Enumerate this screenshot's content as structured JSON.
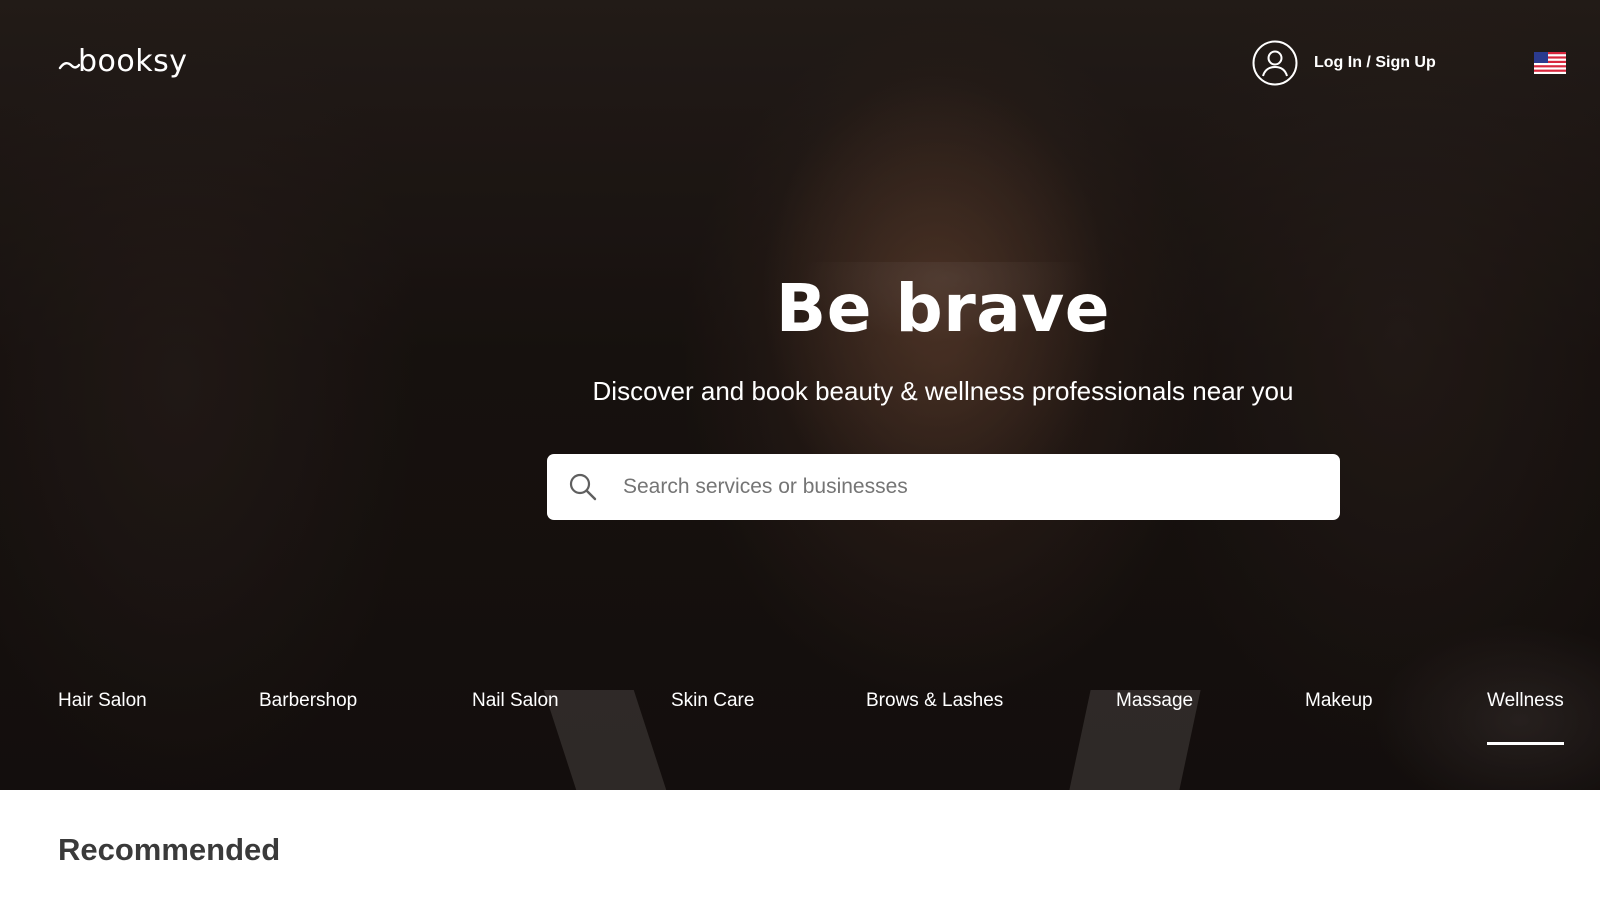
{
  "brand": {
    "name": "booksy"
  },
  "header": {
    "account_label": "Log In / Sign Up",
    "locale_flag": "us-flag-icon"
  },
  "hero": {
    "title": "Be brave",
    "subtitle": "Discover and book beauty & wellness professionals near you"
  },
  "search": {
    "placeholder": "Search services or businesses",
    "value": "",
    "icon": "search-icon"
  },
  "categories": [
    {
      "label": "Hair Salon",
      "active": false
    },
    {
      "label": "Barbershop",
      "active": false
    },
    {
      "label": "Nail Salon",
      "active": false
    },
    {
      "label": "Skin Care",
      "active": false
    },
    {
      "label": "Brows & Lashes",
      "active": false
    },
    {
      "label": "Massage",
      "active": false
    },
    {
      "label": "Makeup",
      "active": false
    },
    {
      "label": "Wellness",
      "active": true
    }
  ],
  "sections": {
    "recommended_title": "Recommended"
  },
  "colors": {
    "hero_overlay": "#1d1613",
    "text_on_hero": "#ffffff",
    "section_title": "#3a3a3a",
    "search_bg": "#ffffff",
    "placeholder": "#757575"
  }
}
